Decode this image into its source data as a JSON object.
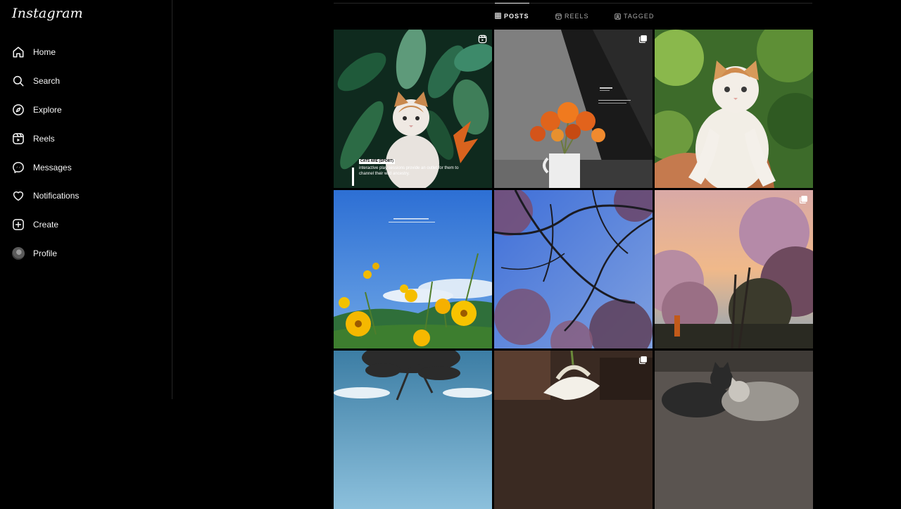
{
  "app": {
    "logo": "Instagram"
  },
  "sidebar": {
    "items": [
      {
        "label": "Home",
        "icon": "home-icon"
      },
      {
        "label": "Search",
        "icon": "search-icon"
      },
      {
        "label": "Explore",
        "icon": "compass-icon"
      },
      {
        "label": "Reels",
        "icon": "reels-icon"
      },
      {
        "label": "Messages",
        "icon": "messenger-icon"
      },
      {
        "label": "Notifications",
        "icon": "heart-icon"
      },
      {
        "label": "Create",
        "icon": "plus-square-icon"
      },
      {
        "label": "Profile",
        "icon": "avatar"
      }
    ]
  },
  "profile_tabs": [
    {
      "label": "POSTS",
      "icon": "grid-icon",
      "active": true
    },
    {
      "label": "REELS",
      "icon": "reels-icon",
      "active": false
    },
    {
      "label": "TAGGED",
      "icon": "tag-icon",
      "active": false
    }
  ],
  "posts": [
    {
      "description": "cat among tropical leaves",
      "badge": "reel-icon",
      "caption_title": "CATS ARE (SPORT)",
      "caption": "interactive play sessions provide an outlet for them to channel their wild ancestry."
    },
    {
      "description": "orange lilies in white vase, black and white wall",
      "badge": "carousel-icon"
    },
    {
      "description": "kitten held in hand",
      "badge": ""
    },
    {
      "description": "yellow cosmos flowers against blue sky",
      "badge": ""
    },
    {
      "description": "tree branches with pink blossoms against blue sky",
      "badge": ""
    },
    {
      "description": "pink flowering trees at sunset",
      "badge": "carousel-icon"
    },
    {
      "description": "tree silhouette and blue sky",
      "badge": ""
    },
    {
      "description": "white flower in dark wood",
      "badge": "carousel-icon"
    },
    {
      "description": "black and grey cats on rock",
      "badge": ""
    }
  ]
}
